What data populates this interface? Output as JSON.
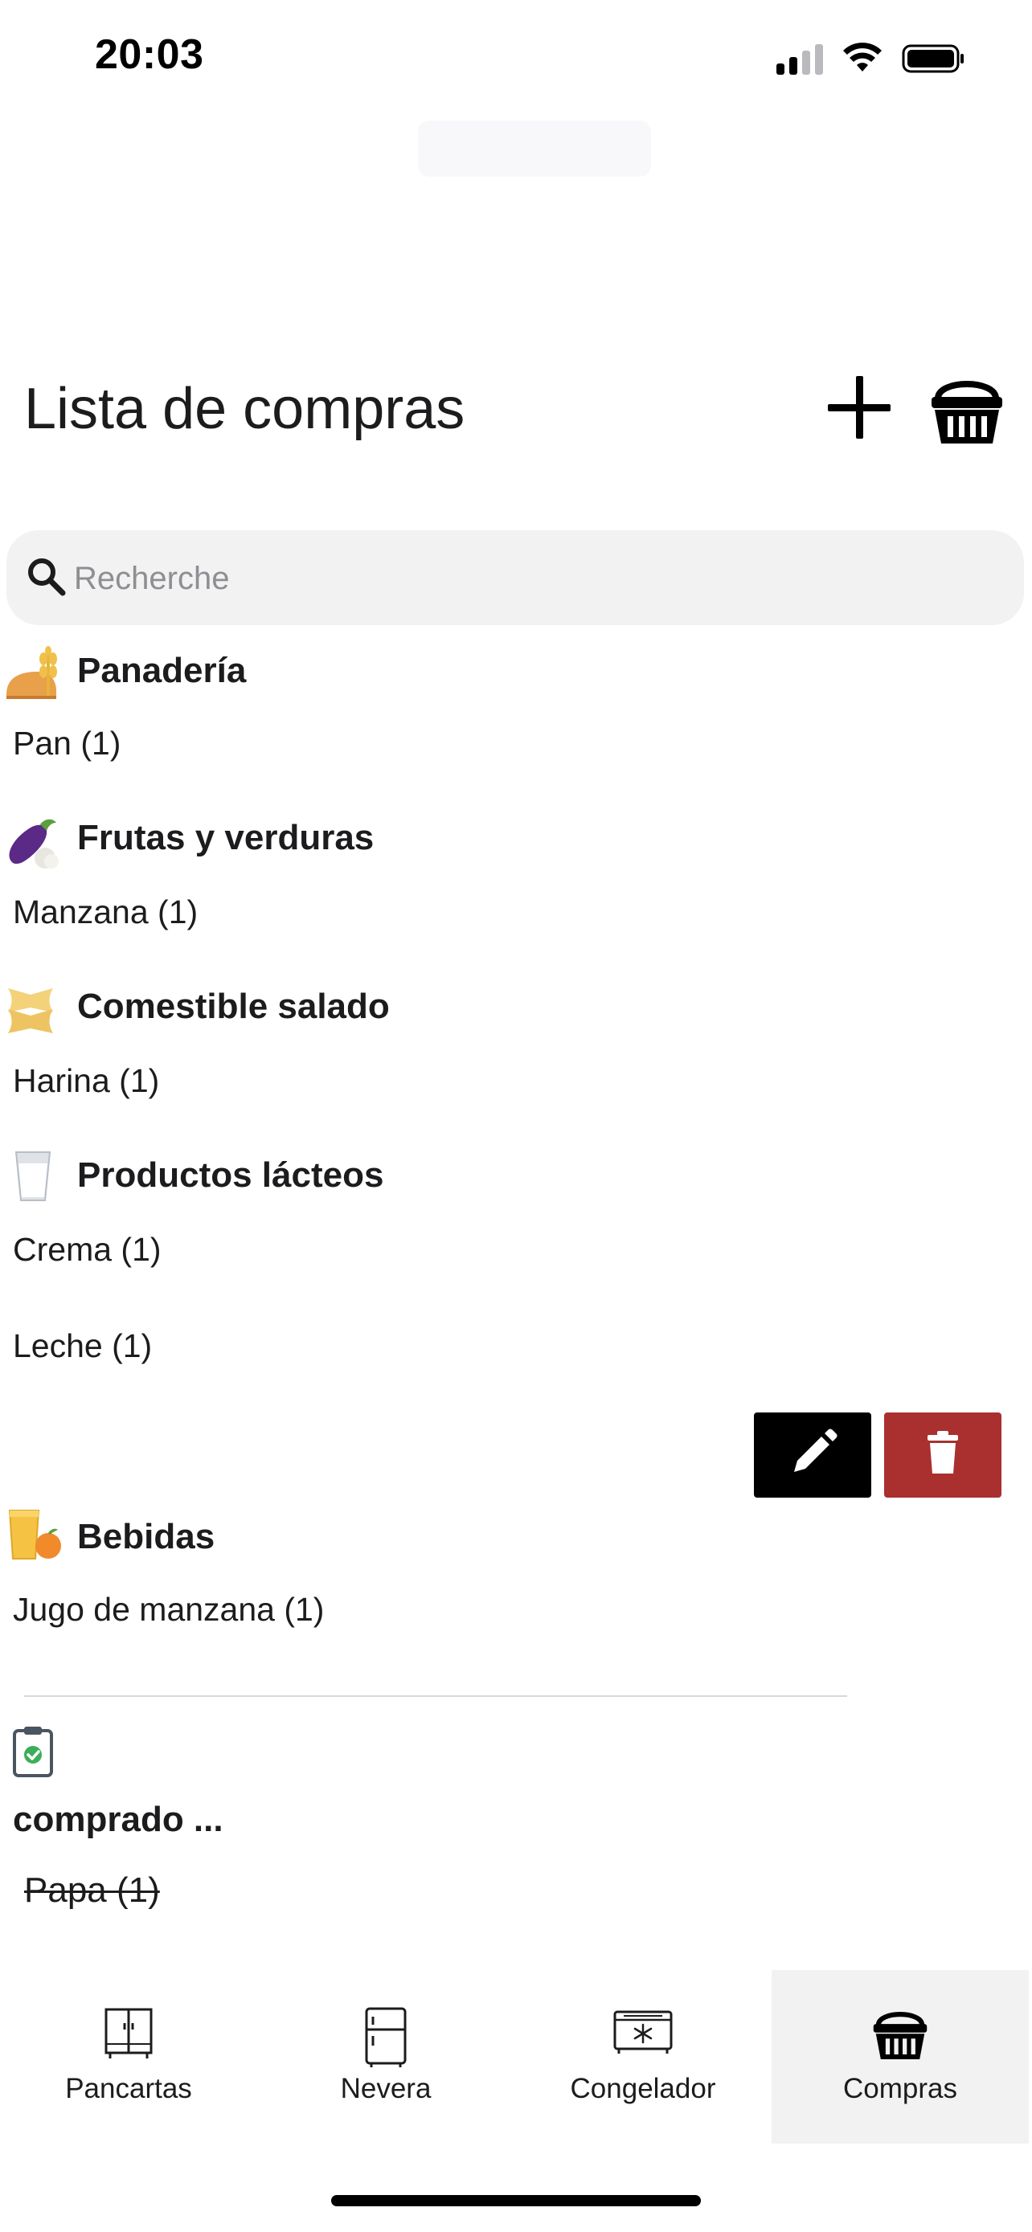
{
  "status_bar": {
    "time": "20:03"
  },
  "header": {
    "title": "Lista de compras"
  },
  "search": {
    "placeholder": "Recherche",
    "value": ""
  },
  "categories": [
    {
      "name": "Panadería",
      "icon": "bread-emoji-icon",
      "items": [
        "Pan (1)"
      ]
    },
    {
      "name": "Frutas y verduras",
      "icon": "eggplant-emoji-icon",
      "items": [
        "Manzana (1)"
      ]
    },
    {
      "name": "Comestible salado",
      "icon": "pasta-emoji-icon",
      "items": [
        "Harina (1)"
      ]
    },
    {
      "name": "Productos lácteos",
      "icon": "milk-glass-emoji-icon",
      "items": [
        "Crema (1)",
        "Leche (1)"
      ]
    },
    {
      "name": "Bebidas",
      "icon": "juice-emoji-icon",
      "items": [
        "Jugo de manzana (1)"
      ]
    }
  ],
  "purchased": {
    "title": "comprado ...",
    "icon": "clipboard-check-icon",
    "items": [
      "Papa (1)"
    ]
  },
  "colors": {
    "delete_red": "#a9302f",
    "edit_black": "#000000",
    "active_tab_bg": "#f2f2f3"
  },
  "tabs": [
    {
      "label": "Pancartas",
      "icon": "cabinet-icon",
      "active": false
    },
    {
      "label": "Nevera",
      "icon": "fridge-icon",
      "active": false
    },
    {
      "label": "Congelador",
      "icon": "freezer-icon",
      "active": false
    },
    {
      "label": "Compras",
      "icon": "shopping-basket-icon",
      "active": true
    }
  ]
}
